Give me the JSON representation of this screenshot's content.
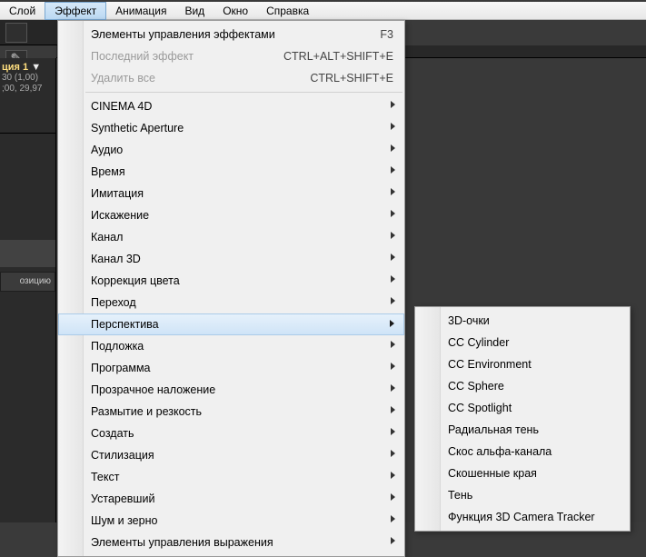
{
  "menubar": {
    "items": [
      "Слой",
      "Эффект",
      "Анимация",
      "Вид",
      "Окно",
      "Справка"
    ]
  },
  "left_panel": {
    "title_prefix": "ция 1",
    "title_arrow": "▼",
    "line1": "30 (1,00)",
    "line2": ";00, 29,97",
    "button": "озицию"
  },
  "menu": {
    "controls": {
      "label": "Элементы управления эффектами",
      "shortcut": "F3"
    },
    "last": {
      "label": "Последний эффект",
      "shortcut": "CTRL+ALT+SHIFT+E"
    },
    "remove": {
      "label": "Удалить все",
      "shortcut": "CTRL+SHIFT+E"
    },
    "groups": [
      "CINEMA 4D",
      "Synthetic Aperture",
      "Аудио",
      "Время",
      "Имитация",
      "Искажение",
      "Канал",
      "Канал 3D",
      "Коррекция цвета",
      "Переход",
      "Перспектива",
      "Подложка",
      "Программа",
      "Прозрачное наложение",
      "Размытие и резкость",
      "Создать",
      "Стилизация",
      "Текст",
      "Устаревший",
      "Шум и зерно",
      "Элементы управления выражения"
    ],
    "hover_index": 10
  },
  "submenu": {
    "items": [
      "3D-очки",
      "CC Cylinder",
      "CC Environment",
      "CC Sphere",
      "CC Spotlight",
      "Радиальная тень",
      "Скос альфа-канала",
      "Скошенные края",
      "Тень",
      "Функция 3D Camera Tracker"
    ]
  }
}
